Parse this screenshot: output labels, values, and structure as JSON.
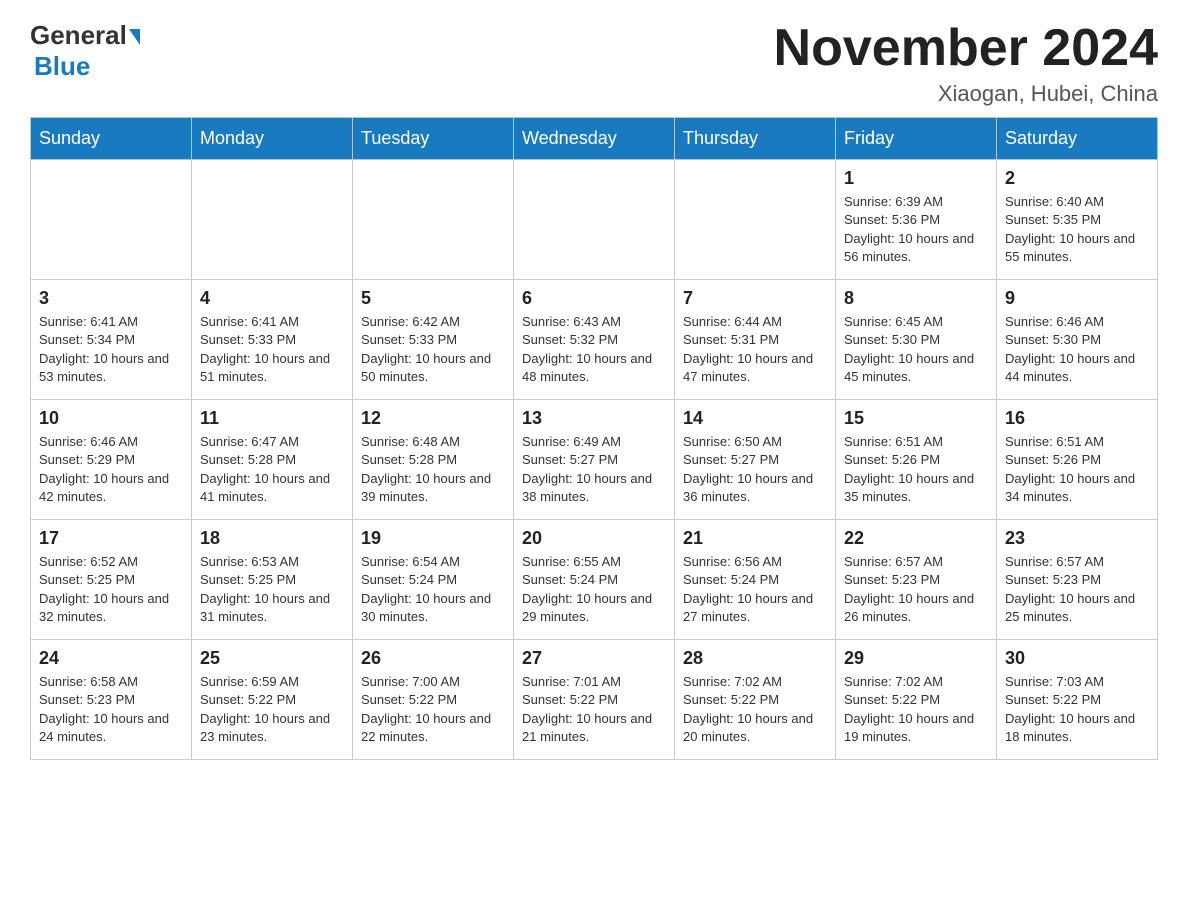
{
  "header": {
    "logo_line1": "General",
    "logo_line2": "Blue",
    "month_title": "November 2024",
    "location": "Xiaogan, Hubei, China"
  },
  "weekdays": [
    "Sunday",
    "Monday",
    "Tuesday",
    "Wednesday",
    "Thursday",
    "Friday",
    "Saturday"
  ],
  "weeks": [
    [
      {
        "day": "",
        "info": ""
      },
      {
        "day": "",
        "info": ""
      },
      {
        "day": "",
        "info": ""
      },
      {
        "day": "",
        "info": ""
      },
      {
        "day": "",
        "info": ""
      },
      {
        "day": "1",
        "info": "Sunrise: 6:39 AM\nSunset: 5:36 PM\nDaylight: 10 hours and 56 minutes."
      },
      {
        "day": "2",
        "info": "Sunrise: 6:40 AM\nSunset: 5:35 PM\nDaylight: 10 hours and 55 minutes."
      }
    ],
    [
      {
        "day": "3",
        "info": "Sunrise: 6:41 AM\nSunset: 5:34 PM\nDaylight: 10 hours and 53 minutes."
      },
      {
        "day": "4",
        "info": "Sunrise: 6:41 AM\nSunset: 5:33 PM\nDaylight: 10 hours and 51 minutes."
      },
      {
        "day": "5",
        "info": "Sunrise: 6:42 AM\nSunset: 5:33 PM\nDaylight: 10 hours and 50 minutes."
      },
      {
        "day": "6",
        "info": "Sunrise: 6:43 AM\nSunset: 5:32 PM\nDaylight: 10 hours and 48 minutes."
      },
      {
        "day": "7",
        "info": "Sunrise: 6:44 AM\nSunset: 5:31 PM\nDaylight: 10 hours and 47 minutes."
      },
      {
        "day": "8",
        "info": "Sunrise: 6:45 AM\nSunset: 5:30 PM\nDaylight: 10 hours and 45 minutes."
      },
      {
        "day": "9",
        "info": "Sunrise: 6:46 AM\nSunset: 5:30 PM\nDaylight: 10 hours and 44 minutes."
      }
    ],
    [
      {
        "day": "10",
        "info": "Sunrise: 6:46 AM\nSunset: 5:29 PM\nDaylight: 10 hours and 42 minutes."
      },
      {
        "day": "11",
        "info": "Sunrise: 6:47 AM\nSunset: 5:28 PM\nDaylight: 10 hours and 41 minutes."
      },
      {
        "day": "12",
        "info": "Sunrise: 6:48 AM\nSunset: 5:28 PM\nDaylight: 10 hours and 39 minutes."
      },
      {
        "day": "13",
        "info": "Sunrise: 6:49 AM\nSunset: 5:27 PM\nDaylight: 10 hours and 38 minutes."
      },
      {
        "day": "14",
        "info": "Sunrise: 6:50 AM\nSunset: 5:27 PM\nDaylight: 10 hours and 36 minutes."
      },
      {
        "day": "15",
        "info": "Sunrise: 6:51 AM\nSunset: 5:26 PM\nDaylight: 10 hours and 35 minutes."
      },
      {
        "day": "16",
        "info": "Sunrise: 6:51 AM\nSunset: 5:26 PM\nDaylight: 10 hours and 34 minutes."
      }
    ],
    [
      {
        "day": "17",
        "info": "Sunrise: 6:52 AM\nSunset: 5:25 PM\nDaylight: 10 hours and 32 minutes."
      },
      {
        "day": "18",
        "info": "Sunrise: 6:53 AM\nSunset: 5:25 PM\nDaylight: 10 hours and 31 minutes."
      },
      {
        "day": "19",
        "info": "Sunrise: 6:54 AM\nSunset: 5:24 PM\nDaylight: 10 hours and 30 minutes."
      },
      {
        "day": "20",
        "info": "Sunrise: 6:55 AM\nSunset: 5:24 PM\nDaylight: 10 hours and 29 minutes."
      },
      {
        "day": "21",
        "info": "Sunrise: 6:56 AM\nSunset: 5:24 PM\nDaylight: 10 hours and 27 minutes."
      },
      {
        "day": "22",
        "info": "Sunrise: 6:57 AM\nSunset: 5:23 PM\nDaylight: 10 hours and 26 minutes."
      },
      {
        "day": "23",
        "info": "Sunrise: 6:57 AM\nSunset: 5:23 PM\nDaylight: 10 hours and 25 minutes."
      }
    ],
    [
      {
        "day": "24",
        "info": "Sunrise: 6:58 AM\nSunset: 5:23 PM\nDaylight: 10 hours and 24 minutes."
      },
      {
        "day": "25",
        "info": "Sunrise: 6:59 AM\nSunset: 5:22 PM\nDaylight: 10 hours and 23 minutes."
      },
      {
        "day": "26",
        "info": "Sunrise: 7:00 AM\nSunset: 5:22 PM\nDaylight: 10 hours and 22 minutes."
      },
      {
        "day": "27",
        "info": "Sunrise: 7:01 AM\nSunset: 5:22 PM\nDaylight: 10 hours and 21 minutes."
      },
      {
        "day": "28",
        "info": "Sunrise: 7:02 AM\nSunset: 5:22 PM\nDaylight: 10 hours and 20 minutes."
      },
      {
        "day": "29",
        "info": "Sunrise: 7:02 AM\nSunset: 5:22 PM\nDaylight: 10 hours and 19 minutes."
      },
      {
        "day": "30",
        "info": "Sunrise: 7:03 AM\nSunset: 5:22 PM\nDaylight: 10 hours and 18 minutes."
      }
    ]
  ]
}
